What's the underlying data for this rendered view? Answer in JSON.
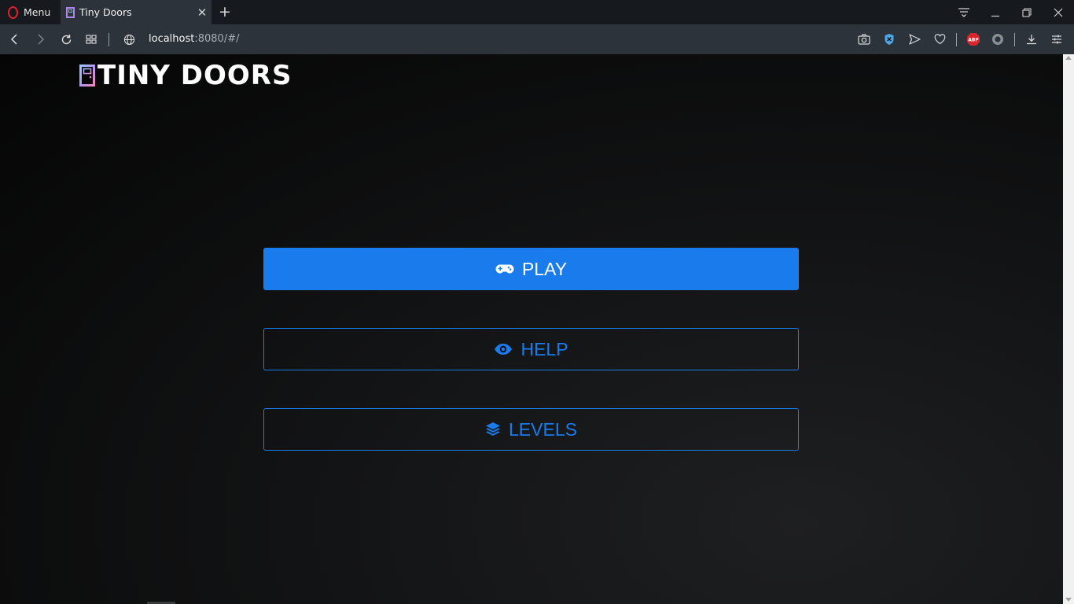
{
  "browser": {
    "menu_label": "Menu",
    "tab": {
      "title": "Tiny Doors"
    },
    "new_tab_symbol": "+",
    "url": {
      "host": "localhost",
      "rest": ":8080/#/"
    },
    "extensions": [
      "camera-icon",
      "shield-x-icon",
      "send-icon",
      "heart-icon",
      "adblock-plus-icon",
      "vpn-circle-icon"
    ]
  },
  "page": {
    "logo": {
      "text": "TINY DOORS",
      "icon": "door-icon"
    },
    "buttons": [
      {
        "label": "PLAY",
        "icon": "gamepad-icon",
        "style": "filled"
      },
      {
        "label": "HELP",
        "icon": "eye-icon",
        "style": "outline"
      },
      {
        "label": "LEVELS",
        "icon": "layers-icon",
        "style": "outline"
      }
    ]
  },
  "colors": {
    "accent": "#1a7cec",
    "opera_red": "#e0202c",
    "abp_red": "#d8262c",
    "chrome_dark": "#16191d",
    "chrome_bar": "#2d333b"
  }
}
